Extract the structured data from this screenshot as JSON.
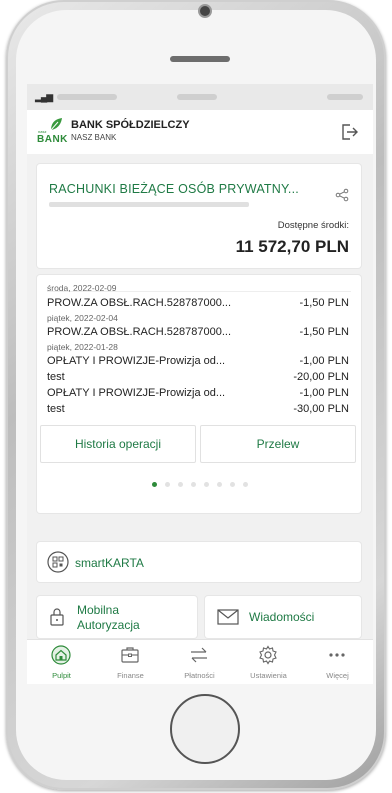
{
  "header": {
    "bank_name": "BANK SPÓŁDZIELCZY",
    "bank_subtitle": "NASZ BANK",
    "logo_text": "BANK",
    "logo_small": "nasz"
  },
  "account": {
    "title": "RACHUNKI BIEŻĄCE OSÓB PRYWATNY...",
    "available_label": "Dostępne środki:",
    "available_value": "11 572,70 PLN"
  },
  "operations": [
    {
      "date": "środa, 2022-02-09",
      "desc": "PROW.ZA OBSŁ.RACH.528787000...",
      "amount": "-1,50 PLN"
    },
    {
      "date": "piątek, 2022-02-04",
      "desc": "PROW.ZA OBSŁ.RACH.528787000...",
      "amount": "-1,50 PLN"
    },
    {
      "date": "piątek, 2022-01-28",
      "desc": "OPŁATY I PROWIZJE-Prowizja od...",
      "amount": "-1,00 PLN"
    },
    {
      "date": "",
      "desc": "test",
      "amount": "-20,00 PLN"
    },
    {
      "date": "",
      "desc": "OPŁATY I PROWIZJE-Prowizja od...",
      "amount": "-1,00 PLN"
    },
    {
      "date": "",
      "desc": "test",
      "amount": "-30,00 PLN"
    }
  ],
  "buttons": {
    "history": "Historia operacji",
    "transfer": "Przelew"
  },
  "tiles": {
    "smartkarta": "smartKARTA",
    "mobile_auth_line1": "Mobilna",
    "mobile_auth_line2": "Autoryzacja",
    "messages": "Wiadomości"
  },
  "nav": [
    {
      "label": "Pulpit",
      "icon": "home-icon"
    },
    {
      "label": "Finanse",
      "icon": "wallet-icon"
    },
    {
      "label": "Płatności",
      "icon": "transfer-arrows-icon"
    },
    {
      "label": "Ustawienia",
      "icon": "gear-icon"
    },
    {
      "label": "Więcej",
      "icon": "more-icon"
    }
  ],
  "colors": {
    "brand_green": "#2e8b3a",
    "text_green": "#1f7a45"
  },
  "pager": {
    "total": 8,
    "active": 1
  }
}
